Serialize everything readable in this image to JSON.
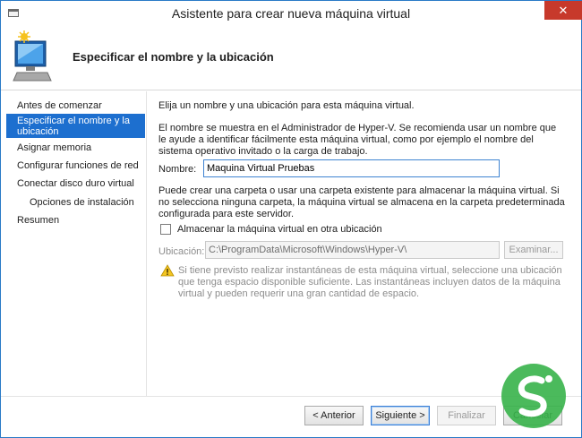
{
  "window": {
    "title": "Asistente para crear nueva máquina virtual",
    "close_glyph": "✕"
  },
  "header": {
    "title": "Especificar el nombre y la ubicación",
    "icon": "wizard-computer-icon"
  },
  "nav": {
    "items": [
      {
        "label": "Antes de comenzar"
      },
      {
        "label": "Especificar el nombre y la ubicación"
      },
      {
        "label": "Asignar memoria"
      },
      {
        "label": "Configurar funciones de red"
      },
      {
        "label": "Conectar disco duro virtual"
      },
      {
        "label": "Opciones de instalación"
      },
      {
        "label": "Resumen"
      }
    ],
    "selected_index": 1
  },
  "content": {
    "intro": "Elija un nombre y una ubicación para esta máquina virtual.",
    "name_help": "El nombre se muestra en el Administrador de Hyper-V. Se recomienda usar un nombre que le ayude a identificar fácilmente esta máquina virtual, como por ejemplo el nombre del sistema operativo invitado o la carga de trabajo.",
    "name_label": "Nombre:",
    "name_value": "Maquina Virtual Pruebas",
    "folder_help": "Puede crear una carpeta o usar una carpeta existente para almacenar la máquina virtual. Si no selecciona ninguna carpeta, la máquina virtual se almacena en la carpeta predeterminada configurada para este servidor.",
    "checkbox_label": "Almacenar la máquina virtual en otra ubicación",
    "checkbox_checked": false,
    "location_label": "Ubicación:",
    "location_value": "C:\\ProgramData\\Microsoft\\Windows\\Hyper-V\\",
    "browse_label": "Examinar...",
    "warning_text": "Si tiene previsto realizar instantáneas de esta máquina virtual, seleccione una ubicación que tenga espacio disponible suficiente. Las instantáneas incluyen datos de la máquina virtual y pueden requerir una gran cantidad de espacio."
  },
  "footer": {
    "back_label": "< Anterior",
    "next_label": "Siguiente >",
    "finish_label": "Finalizar",
    "cancel_label": "Cancelar"
  },
  "colors": {
    "accent": "#1d6fcf",
    "close": "#c7392b",
    "logo": "#37b34a"
  }
}
